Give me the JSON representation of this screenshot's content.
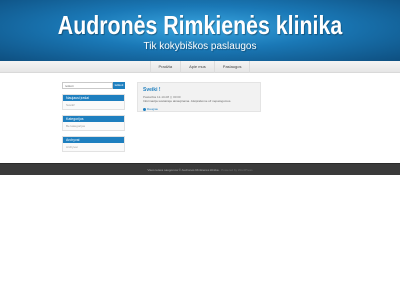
{
  "header": {
    "title": "Audronės Rimkienės klinika",
    "tagline": "Tik kokybiškos paslaugos"
  },
  "nav": {
    "items": [
      {
        "label": "Pradžia"
      },
      {
        "label": "Apie mus"
      },
      {
        "label": "Paslaugos"
      }
    ]
  },
  "sidebar": {
    "search": {
      "placeholder": "Ieškoti",
      "button_label": "Ieškoti"
    },
    "widgets": [
      {
        "title": "Naujausi įrašai",
        "item": "Sveiki!"
      },
      {
        "title": "Kategorijos",
        "item": "Be kategorijos"
      },
      {
        "title": "Archyvai",
        "item": "Archyvai"
      }
    ]
  },
  "post": {
    "title": "Sveiki !",
    "meta": "Paskelbta 12-10-08 | | 00:00",
    "excerpt": "Informacija svetainėje atnaujinama. Atsiprašome už nepatogumus.",
    "more_label": "Daugiau"
  },
  "footer": {
    "text": "Visos teisės saugomos © Audronės Rimkienės klinika",
    "link": "Powered by WordPress"
  },
  "colors": {
    "accent": "#1e7fbf",
    "header_dark": "#0e4f80",
    "footer_bg": "#3a3a3a"
  }
}
